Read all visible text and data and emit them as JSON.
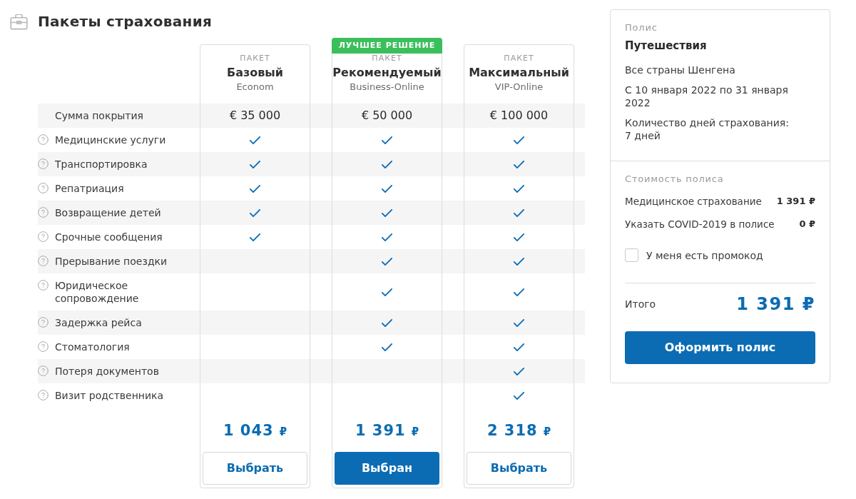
{
  "header": {
    "title": "Пакеты страхования"
  },
  "coverage_label": "Сумма покрытия",
  "plans": [
    {
      "overline": "ПАКЕТ",
      "name": "Базовый",
      "tier": "Econom",
      "coverage": "€ 35 000",
      "price": "1 043",
      "currency": "₽",
      "button": "Выбрать",
      "selected": false
    },
    {
      "badge": "ЛУЧШЕЕ РЕШЕНИЕ",
      "overline": "ПАКЕТ",
      "name": "Рекомендуемый",
      "tier": "Business-Online",
      "coverage": "€ 50 000",
      "price": "1 391",
      "currency": "₽",
      "button": "Выбран",
      "selected": true
    },
    {
      "overline": "ПАКЕТ",
      "name": "Максимальный",
      "tier": "VIP-Online",
      "coverage": "€ 100 000",
      "price": "2 318",
      "currency": "₽",
      "button": "Выбрать",
      "selected": false
    }
  ],
  "features": [
    {
      "label": "Медицинские услуги",
      "included": [
        true,
        true,
        true
      ]
    },
    {
      "label": "Транспортировка",
      "included": [
        true,
        true,
        true
      ]
    },
    {
      "label": "Репатриация",
      "included": [
        true,
        true,
        true
      ]
    },
    {
      "label": "Возвращение детей",
      "included": [
        true,
        true,
        true
      ]
    },
    {
      "label": "Срочные сообщения",
      "included": [
        true,
        true,
        true
      ]
    },
    {
      "label": "Прерывание поездки",
      "included": [
        false,
        true,
        true
      ]
    },
    {
      "label": "Юридическое сопровождение",
      "included": [
        false,
        true,
        true
      ]
    },
    {
      "label": "Задержка рейса",
      "included": [
        false,
        true,
        true
      ]
    },
    {
      "label": "Стоматология",
      "included": [
        false,
        true,
        true
      ]
    },
    {
      "label": "Потеря документов",
      "included": [
        false,
        false,
        true
      ]
    },
    {
      "label": "Визит родственника",
      "included": [
        false,
        false,
        true
      ]
    }
  ],
  "policy": {
    "overline": "Полис",
    "title": "Путешествия",
    "details": [
      "Все страны Шенгена",
      "С 10 января 2022 по 31 января 2022",
      "Количество дней страхования: 7 дней"
    ],
    "cost_heading": "Стоимость полиса",
    "cost_items": [
      {
        "label": "Медицинское страхование",
        "amount": "1 391 ₽"
      },
      {
        "label": "Указать COVID-2019 в полисе",
        "amount": "0 ₽"
      }
    ],
    "promo": {
      "label": "У меня есть промокод",
      "checked": false
    },
    "total": {
      "label": "Итого",
      "amount": "1 391 ₽"
    },
    "submit": "Оформить полис"
  }
}
